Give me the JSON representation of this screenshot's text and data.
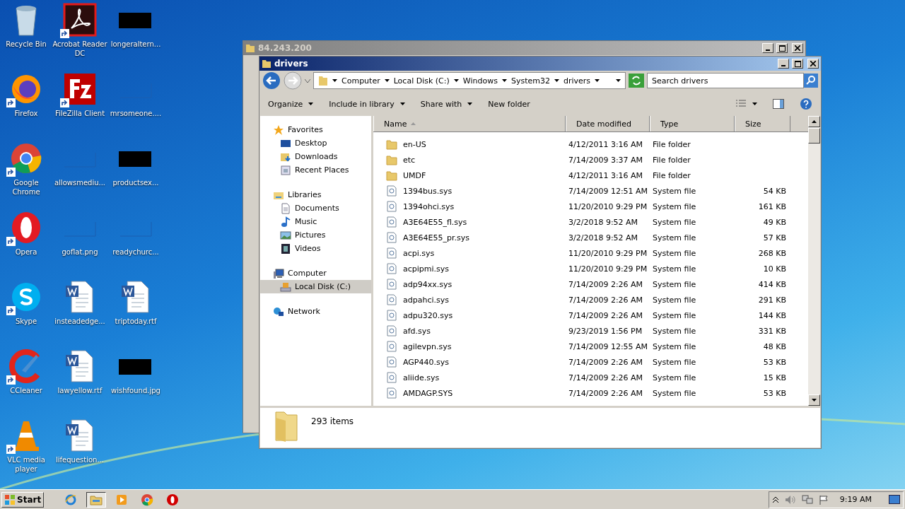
{
  "desktop_icons": [
    {
      "label": "Recycle Bin",
      "kind": "recycle",
      "shortcut": false
    },
    {
      "label": "Firefox",
      "kind": "firefox",
      "shortcut": true
    },
    {
      "label": "Google Chrome",
      "kind": "chrome",
      "shortcut": true
    },
    {
      "label": "Opera",
      "kind": "opera",
      "shortcut": true
    },
    {
      "label": "Skype",
      "kind": "skype",
      "shortcut": true
    },
    {
      "label": "CCleaner",
      "kind": "ccleaner",
      "shortcut": true
    },
    {
      "label": "VLC media player",
      "kind": "vlc",
      "shortcut": true
    },
    {
      "label": "Acrobat Reader DC",
      "kind": "acrobat",
      "shortcut": true
    },
    {
      "label": "FileZilla Client",
      "kind": "filezilla",
      "shortcut": true
    },
    {
      "label": "allowsmediu...",
      "kind": "blank",
      "shortcut": false
    },
    {
      "label": "goflat.png",
      "kind": "blank",
      "shortcut": false
    },
    {
      "label": "insteadedge...",
      "kind": "word",
      "shortcut": false
    },
    {
      "label": "lawyellow.rtf",
      "kind": "word",
      "shortcut": false
    },
    {
      "label": "lifequestion...",
      "kind": "word",
      "shortcut": false
    },
    {
      "label": "longeraltern...",
      "kind": "black",
      "shortcut": false
    },
    {
      "label": "mrsomeone....",
      "kind": "blank",
      "shortcut": false
    },
    {
      "label": "productsex...",
      "kind": "black",
      "shortcut": false
    },
    {
      "label": "readychurc...",
      "kind": "blank",
      "shortcut": false
    },
    {
      "label": "triptoday.rtf",
      "kind": "word",
      "shortcut": false
    },
    {
      "label": "wishfound.jpg",
      "kind": "black",
      "shortcut": false
    }
  ],
  "back_window": {
    "title": "84.243.200"
  },
  "window": {
    "title": "drivers",
    "address": [
      "Computer",
      "Local Disk (C:)",
      "Windows",
      "System32",
      "drivers"
    ],
    "search": {
      "placeholder": "Search drivers"
    },
    "toolbar": [
      {
        "label": "Organize",
        "dropdown": true
      },
      {
        "label": "Include in library",
        "dropdown": true
      },
      {
        "label": "Share with",
        "dropdown": true
      },
      {
        "label": "New folder",
        "dropdown": false
      }
    ],
    "nav": [
      {
        "label": "Favorites",
        "kind": "star",
        "selected": false,
        "children": [
          {
            "label": "Desktop",
            "kind": "desktop",
            "selected": false
          },
          {
            "label": "Downloads",
            "kind": "downloads",
            "selected": false
          },
          {
            "label": "Recent Places",
            "kind": "recent",
            "selected": false
          }
        ]
      },
      {
        "label": "Libraries",
        "kind": "library",
        "selected": false,
        "children": [
          {
            "label": "Documents",
            "kind": "documents",
            "selected": false
          },
          {
            "label": "Music",
            "kind": "music",
            "selected": false
          },
          {
            "label": "Pictures",
            "kind": "pictures",
            "selected": false
          },
          {
            "label": "Videos",
            "kind": "videos",
            "selected": false
          }
        ]
      },
      {
        "label": "Computer",
        "kind": "computer",
        "selected": false,
        "children": [
          {
            "label": "Local Disk (C:)",
            "kind": "disk",
            "selected": true
          }
        ]
      },
      {
        "label": "Network",
        "kind": "network",
        "selected": false
      }
    ],
    "columns": [
      "Name",
      "Date modified",
      "Type",
      "Size"
    ],
    "rows": [
      {
        "kind": "folder",
        "name": "en-US",
        "date": "4/12/2011 3:16 AM",
        "type": "File folder"
      },
      {
        "kind": "folder",
        "name": "etc",
        "date": "7/14/2009 3:37 AM",
        "type": "File folder"
      },
      {
        "kind": "folder",
        "name": "UMDF",
        "date": "4/12/2011 3:16 AM",
        "type": "File folder"
      },
      {
        "kind": "file",
        "name": "1394bus.sys",
        "date": "7/14/2009 12:51 AM",
        "type": "System file",
        "size": "54 KB"
      },
      {
        "kind": "file",
        "name": "1394ohci.sys",
        "date": "11/20/2010 9:29 PM",
        "type": "System file",
        "size": "161 KB"
      },
      {
        "kind": "file",
        "name": "A3E64E55_fl.sys",
        "date": "3/2/2018 9:52 AM",
        "type": "System file",
        "size": "49 KB"
      },
      {
        "kind": "file",
        "name": "A3E64E55_pr.sys",
        "date": "3/2/2018 9:52 AM",
        "type": "System file",
        "size": "57 KB"
      },
      {
        "kind": "file",
        "name": "acpi.sys",
        "date": "11/20/2010 9:29 PM",
        "type": "System file",
        "size": "268 KB"
      },
      {
        "kind": "file",
        "name": "acpipmi.sys",
        "date": "11/20/2010 9:29 PM",
        "type": "System file",
        "size": "10 KB"
      },
      {
        "kind": "file",
        "name": "adp94xx.sys",
        "date": "7/14/2009 2:26 AM",
        "type": "System file",
        "size": "414 KB"
      },
      {
        "kind": "file",
        "name": "adpahci.sys",
        "date": "7/14/2009 2:26 AM",
        "type": "System file",
        "size": "291 KB"
      },
      {
        "kind": "file",
        "name": "adpu320.sys",
        "date": "7/14/2009 2:26 AM",
        "type": "System file",
        "size": "144 KB"
      },
      {
        "kind": "file",
        "name": "afd.sys",
        "date": "9/23/2019 1:56 PM",
        "type": "System file",
        "size": "331 KB"
      },
      {
        "kind": "file",
        "name": "agilevpn.sys",
        "date": "7/14/2009 12:55 AM",
        "type": "System file",
        "size": "48 KB"
      },
      {
        "kind": "file",
        "name": "AGP440.sys",
        "date": "7/14/2009 2:26 AM",
        "type": "System file",
        "size": "53 KB"
      },
      {
        "kind": "file",
        "name": "aliide.sys",
        "date": "7/14/2009 2:26 AM",
        "type": "System file",
        "size": "15 KB"
      },
      {
        "kind": "file",
        "name": "AMDAGP.SYS",
        "date": "7/14/2009 2:26 AM",
        "type": "System file",
        "size": "53 KB"
      }
    ],
    "status": "293 items"
  },
  "taskbar": {
    "start": "Start",
    "apps": [
      {
        "kind": "ie",
        "selected": false
      },
      {
        "kind": "explorer",
        "selected": true
      },
      {
        "kind": "media",
        "selected": false
      },
      {
        "kind": "chrome",
        "selected": false
      },
      {
        "kind": "opera",
        "selected": false
      }
    ],
    "clock": "9:19 AM"
  }
}
